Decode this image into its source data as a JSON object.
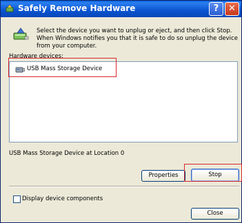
{
  "window": {
    "title": "Safely Remove Hardware",
    "help_label": "?",
    "close_label": "✕"
  },
  "intro": {
    "text": "Select the device you want to unplug or eject, and then click Stop. When Windows notifies you that it is safe to do so unplug the device from your computer."
  },
  "hardware": {
    "label": "Hardware devices:",
    "devices": [
      {
        "name": "USB Mass Storage Device",
        "icon": "usb-drive-icon"
      }
    ],
    "selected_location": "USB Mass Storage Device at Location 0"
  },
  "buttons": {
    "properties": "Properties",
    "stop": "Stop",
    "close": "Close"
  },
  "options": {
    "display_components_label": "Display device components",
    "display_components_checked": false
  },
  "colors": {
    "titlebar": "#0a54d0",
    "highlight_annotation": "#d9252d",
    "dialog_bg": "#ece9d8"
  }
}
